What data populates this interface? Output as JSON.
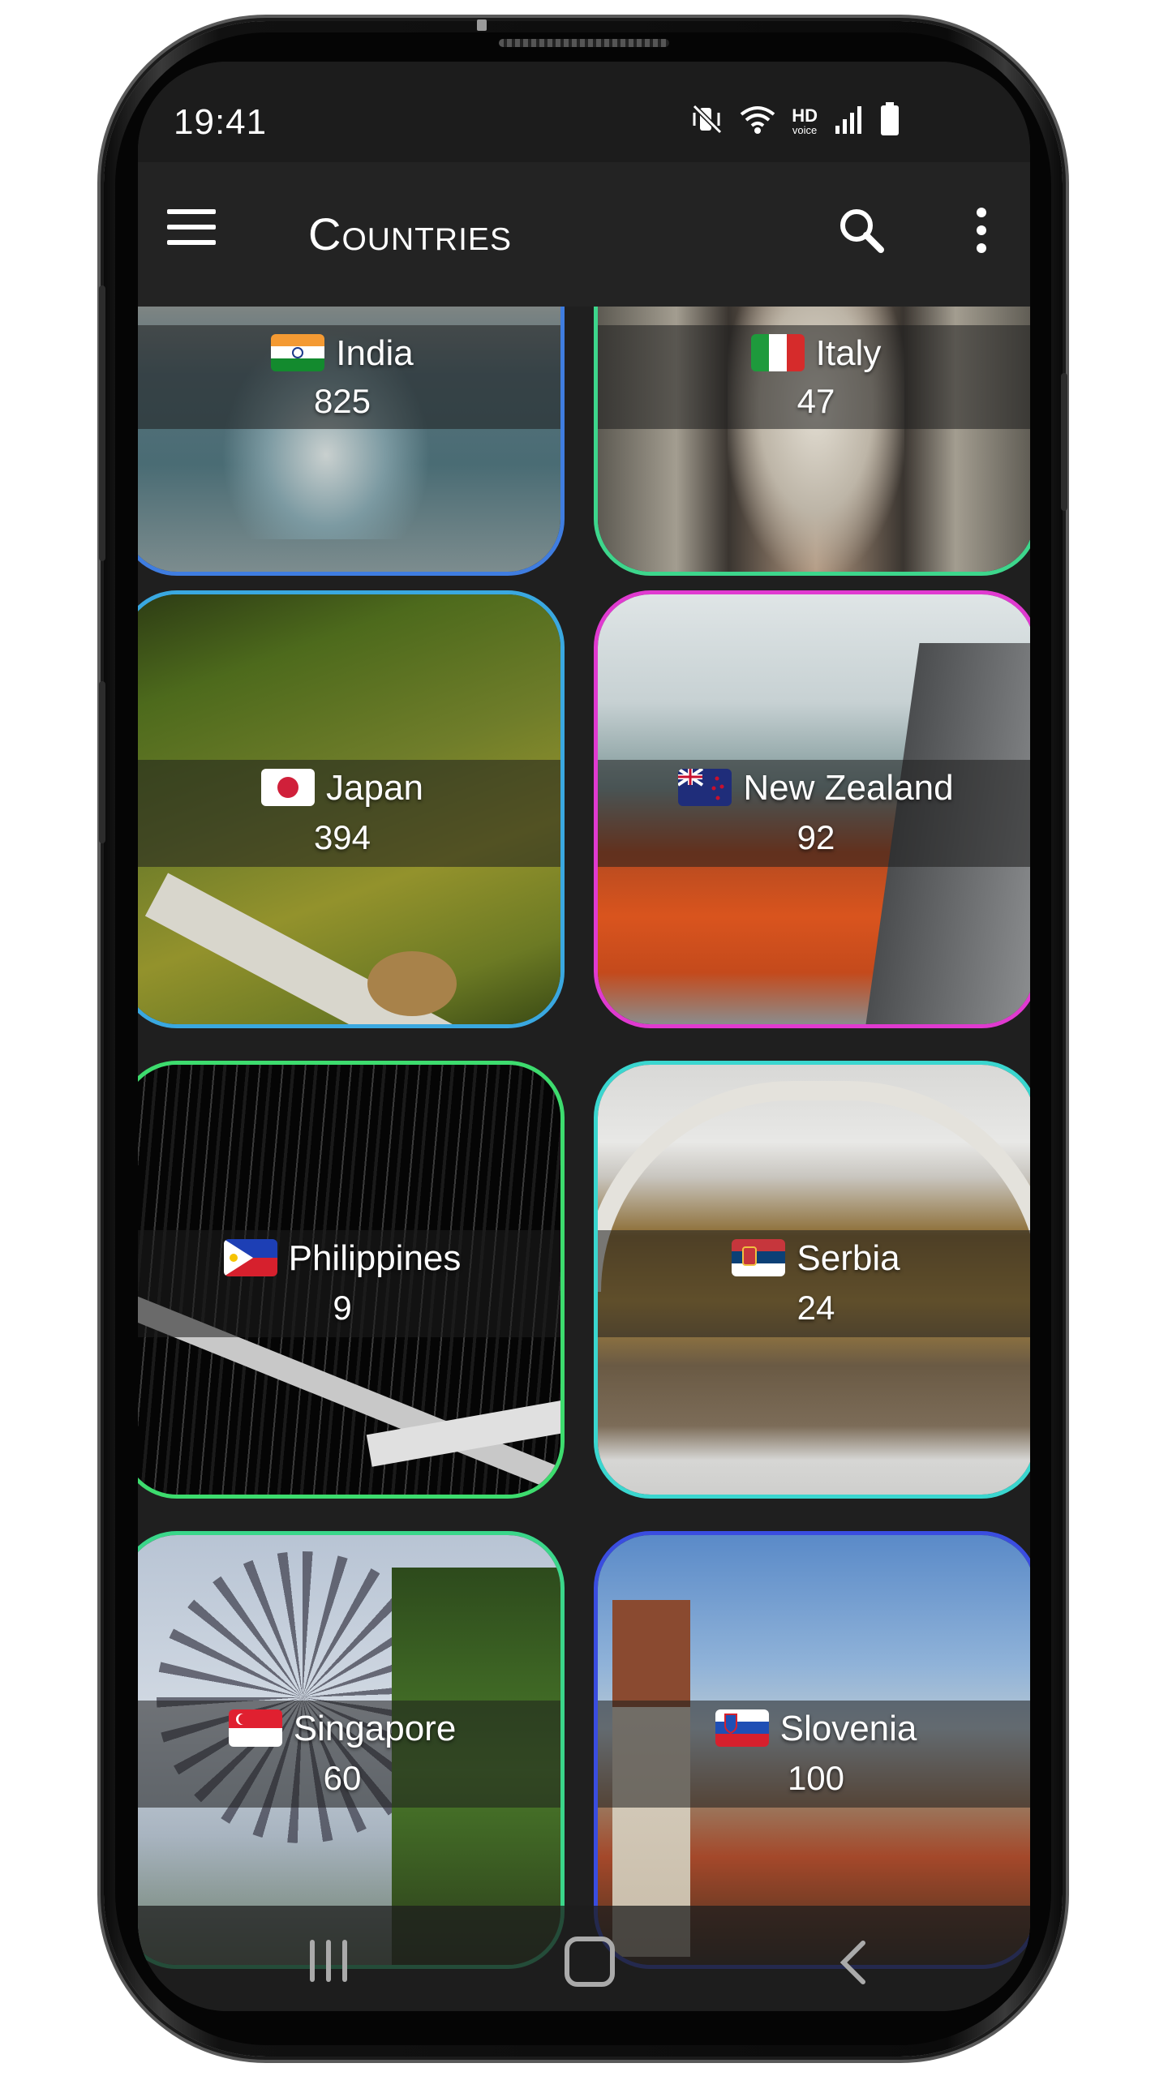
{
  "status_bar": {
    "time": "19:41",
    "hd_label": "HD",
    "voice_label": "voice"
  },
  "app_bar": {
    "title": "Countries"
  },
  "countries": [
    {
      "name": "India",
      "count": "825",
      "border": "#3f7de0"
    },
    {
      "name": "Italy",
      "count": "47",
      "border": "#3dd68c"
    },
    {
      "name": "Japan",
      "count": "394",
      "border": "#3aa8e0"
    },
    {
      "name": "New Zealand",
      "count": "92",
      "border": "#e03ad0"
    },
    {
      "name": "Philippines",
      "count": "9",
      "border": "#3ddc6e"
    },
    {
      "name": "Serbia",
      "count": "24",
      "border": "#3ad6cf"
    },
    {
      "name": "Singapore",
      "count": "60",
      "border": "#3ad68a"
    },
    {
      "name": "Slovenia",
      "count": "100",
      "border": "#3a4de0"
    }
  ],
  "icons": {
    "menu": "hamburger-menu-icon",
    "search": "search-icon",
    "more": "more-vert-icon",
    "mute": "vibrate-mute-icon",
    "wifi": "wifi-icon",
    "signal": "signal-icon",
    "battery": "battery-icon",
    "nav_recent": "recent-apps-icon",
    "nav_home": "home-icon",
    "nav_back": "back-icon"
  }
}
